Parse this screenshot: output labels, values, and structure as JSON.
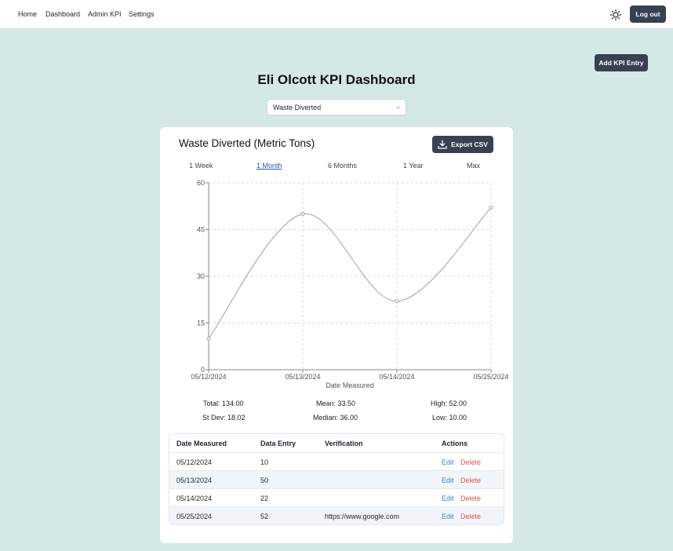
{
  "nav": {
    "links": [
      "Home",
      "Dashboard",
      "Admin KPI",
      "Settings"
    ],
    "logout_label": "Log out",
    "theme_icon": "sun-icon"
  },
  "add_kpi_label": "Add KPI Entry",
  "page_title": "Eli Olcott KPI Dashboard",
  "kpi_select": {
    "value": "Waste Diverted",
    "icon": "chevron-down-icon"
  },
  "card": {
    "title": "Waste Diverted (Metric Tons)",
    "export_label": "Export CSV",
    "export_icon": "download-icon",
    "ranges": [
      "1 Week",
      "1 Month",
      "6 Months",
      "1 Year",
      "Max"
    ],
    "active_range": "1 Month"
  },
  "chart_data": {
    "type": "line",
    "x": [
      "05/12/2024",
      "05/13/2024",
      "05/14/2024",
      "05/25/2024"
    ],
    "values": [
      10,
      50,
      22,
      52
    ],
    "xlabel": "Date Measured",
    "ylabel": "",
    "ylim": [
      0,
      60
    ],
    "yticks": [
      "0",
      "15",
      "30",
      "45",
      "60"
    ],
    "grid": true,
    "line_color": "#a0a0a0"
  },
  "stats": {
    "total": "Total: 134.00",
    "mean": "Mean: 33.50",
    "high": "High: 52.00",
    "stdev": "St Dev: 18.02",
    "median": "Median: 36.00",
    "low": "Low: 10.00"
  },
  "table": {
    "headers": [
      "Date Measured",
      "Data Entry",
      "Verification",
      "Actions"
    ],
    "rows": [
      {
        "date": "05/12/2024",
        "value": "10",
        "verification": "",
        "edit": "Edit",
        "delete": "Delete"
      },
      {
        "date": "05/13/2024",
        "value": "50",
        "verification": "",
        "edit": "Edit",
        "delete": "Delete"
      },
      {
        "date": "05/14/2024",
        "value": "22",
        "verification": "",
        "edit": "Edit",
        "delete": "Delete"
      },
      {
        "date": "05/25/2024",
        "value": "52",
        "verification": "https://www.google.com",
        "edit": "Edit",
        "delete": "Delete"
      }
    ]
  },
  "colors": {
    "background": "#d4e8e6",
    "button_dark": "#374151",
    "link_blue": "#3b82c4",
    "delete_red": "#d9534f"
  }
}
